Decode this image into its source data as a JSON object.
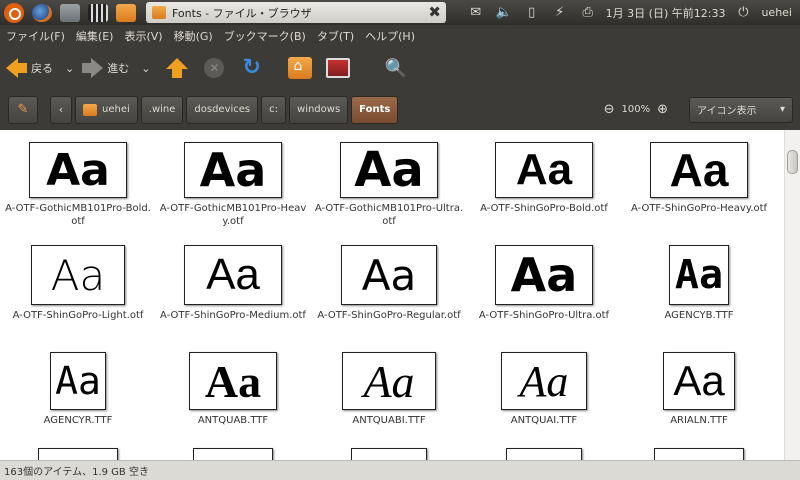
{
  "panel": {
    "window_title": "Fonts - ファイル・ブラウザ",
    "clock": "1月 3日 (日) 午前12:33",
    "username": "uehei"
  },
  "menu": [
    "ファイル(F)",
    "編集(E)",
    "表示(V)",
    "移動(G)",
    "ブックマーク(B)",
    "タブ(T)",
    "ヘルプ(H)"
  ],
  "toolbar": {
    "back_label": "戻る",
    "forward_label": "進む"
  },
  "location": {
    "crumbs": [
      "uehei",
      ".wine",
      "dosdevices",
      "c:",
      "windows",
      "Fonts"
    ],
    "zoom": "100%",
    "view_mode": "アイコン表示"
  },
  "files": [
    {
      "name": "A-OTF-GothicMB101Pro-Bold.otf"
    },
    {
      "name": "A-OTF-GothicMB101Pro-Heavy.otf"
    },
    {
      "name": "A-OTF-GothicMB101Pro-Ultra.otf"
    },
    {
      "name": "A-OTF-ShinGoPro-Bold.otf"
    },
    {
      "name": "A-OTF-ShinGoPro-Heavy.otf"
    },
    {
      "name": "A-OTF-ShinGoPro-Light.otf"
    },
    {
      "name": "A-OTF-ShinGoPro-Medium.otf"
    },
    {
      "name": "A-OTF-ShinGoPro-Regular.otf"
    },
    {
      "name": "A-OTF-ShinGoPro-Ultra.otf"
    },
    {
      "name": "AGENCYB.TTF"
    },
    {
      "name": "AGENCYR.TTF"
    },
    {
      "name": "ANTQUAB.TTF"
    },
    {
      "name": "ANTQUABI.TTF"
    },
    {
      "name": "ANTQUAI.TTF"
    },
    {
      "name": "ARIALN.TTF"
    }
  ],
  "preview_text": "Aa",
  "status": "163個のアイテム、1.9 GB 空き"
}
